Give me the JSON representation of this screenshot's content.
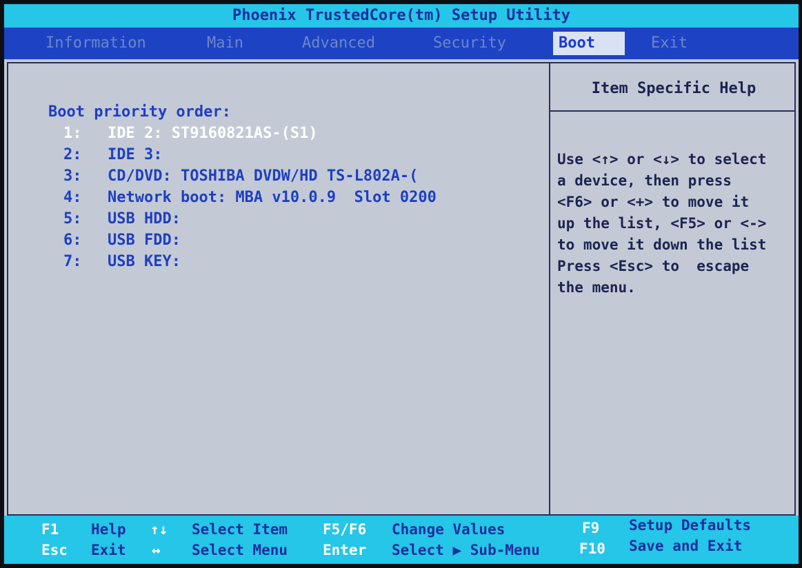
{
  "title": "Phoenix TrustedCore(tm) Setup Utility",
  "menu": {
    "tabs": [
      "Information",
      "Main",
      "Advanced",
      "Security",
      "Boot",
      "Exit"
    ],
    "active": "Boot"
  },
  "boot": {
    "section_title": "Boot priority order:",
    "items": [
      {
        "num": "1:",
        "label": "IDE 2: ST9160821AS-(S1)"
      },
      {
        "num": "2:",
        "label": "IDE 3:"
      },
      {
        "num": "3:",
        "label": "CD/DVD: TOSHIBA DVDW/HD TS-L802A-("
      },
      {
        "num": "4:",
        "label": "Network boot: MBA v10.0.9  Slot 0200"
      },
      {
        "num": "5:",
        "label": "USB HDD:"
      },
      {
        "num": "6:",
        "label": "USB FDD:"
      },
      {
        "num": "7:",
        "label": "USB KEY:"
      }
    ]
  },
  "help": {
    "title": "Item Specific Help",
    "lines": [
      "Use <↑> or <↓> to select",
      "a device, then press",
      "<F6> or <+> to move it",
      "up the list, <F5> or <->",
      "to move it down the list",
      "Press <Esc> to  escape",
      "the menu."
    ]
  },
  "footer": {
    "f1_key": "F1",
    "f1_label": "Help",
    "updown_key": "↑↓",
    "updown_label": "Select Item",
    "f5f6_key": "F5/F6",
    "f5f6_label": "Change Values",
    "f9_key": "F9",
    "f9_label": "Setup Defaults",
    "esc_key": "Esc",
    "esc_label": "Exit",
    "leftright_key": "↔",
    "leftright_label": "Select Menu",
    "enter_key": "Enter",
    "enter_label": "Select ▶ Sub-Menu",
    "f10_key": "F10",
    "f10_label": "Save and Exit"
  },
  "colors": {
    "title_bar": "#25c6e8",
    "menu_bar": "#1d43c4",
    "panel_bg": "#c3cad6",
    "text_blue": "#1f3fc0",
    "selected_text": "#ffffff"
  }
}
